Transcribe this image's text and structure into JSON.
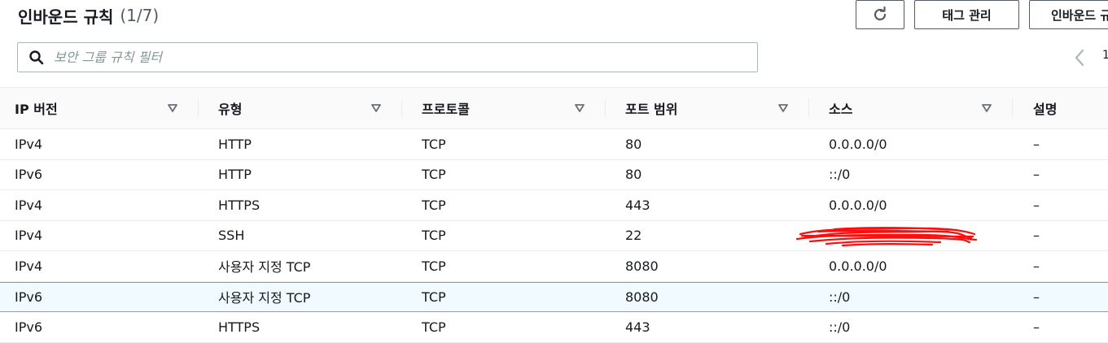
{
  "header": {
    "title": "인바운드 규칙",
    "count": "(1/7)",
    "buttons": {
      "tags_label": "태그 관리",
      "edit_inbound_label": "인바운드 규칙 편집"
    }
  },
  "search": {
    "placeholder": "보안 그룹 규칙 필터",
    "value": ""
  },
  "pagination": {
    "current_page": "1"
  },
  "table": {
    "columns": [
      "IP 버전",
      "유형",
      "프로토콜",
      "포트 범위",
      "소스",
      "설명"
    ],
    "rows": [
      {
        "ip_version": "IPv4",
        "type": "HTTP",
        "protocol": "TCP",
        "port_range": "80",
        "source": "0.0.0.0/0",
        "description": "–",
        "selected": false
      },
      {
        "ip_version": "IPv6",
        "type": "HTTP",
        "protocol": "TCP",
        "port_range": "80",
        "source": "::/0",
        "description": "–",
        "selected": false
      },
      {
        "ip_version": "IPv4",
        "type": "HTTPS",
        "protocol": "TCP",
        "port_range": "443",
        "source": "0.0.0.0/0",
        "description": "–",
        "selected": false
      },
      {
        "ip_version": "IPv4",
        "type": "SSH",
        "protocol": "TCP",
        "port_range": "22",
        "source": "",
        "description": "–",
        "selected": false
      },
      {
        "ip_version": "IPv4",
        "type": "사용자 지정 TCP",
        "protocol": "TCP",
        "port_range": "8080",
        "source": "0.0.0.0/0",
        "description": "–",
        "selected": false
      },
      {
        "ip_version": "IPv6",
        "type": "사용자 지정 TCP",
        "protocol": "TCP",
        "port_range": "8080",
        "source": "::/0",
        "description": "–",
        "selected": true
      },
      {
        "ip_version": "IPv6",
        "type": "HTTPS",
        "protocol": "TCP",
        "port_range": "443",
        "source": "::/0",
        "description": "–",
        "selected": false
      }
    ]
  },
  "colors": {
    "text": "#16191f",
    "border": "#eaeded",
    "selected_border": "#44b9d6",
    "selected_bg": "#f1faff",
    "redaction": "#ff0000"
  },
  "icons": {
    "refresh": "refresh-icon",
    "search": "search-icon",
    "sort": "sort-caret-down-icon",
    "prev_page": "chevron-left-icon"
  }
}
